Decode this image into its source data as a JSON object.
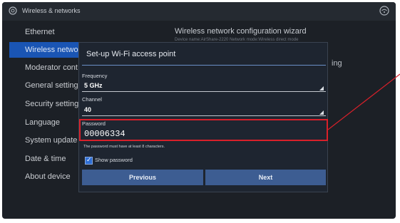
{
  "topbar": {
    "title": "Wireless & networks",
    "settings_icon": "settings-icon",
    "network_icon": "network-icon"
  },
  "sidebar": {
    "items": [
      {
        "label": "Ethernet"
      },
      {
        "label": "Wireless netwo"
      },
      {
        "label": "Moderator cont"
      },
      {
        "label": "General setting"
      },
      {
        "label": "Security setting"
      },
      {
        "label": "Language"
      },
      {
        "label": "System update"
      },
      {
        "label": "Date & time"
      },
      {
        "label": "About device"
      }
    ]
  },
  "right_panel": {
    "wizard_title": "Wireless network configuration wizard",
    "wizard_subtitle": "Device name:AirShare-2220   Network mode:Wireless direct mode",
    "fragment": "ing"
  },
  "dialog": {
    "title": "Set-up Wi-Fi access point",
    "frequency": {
      "label": "Frequency",
      "value": "5 GHz"
    },
    "channel": {
      "label": "Channel",
      "value": "40"
    },
    "password": {
      "label": "Password",
      "value": "00006334"
    },
    "hint": "The password must have at least 8 characters.",
    "show_password": {
      "label": "Show password",
      "checked": true
    },
    "buttons": {
      "previous": "Previous",
      "next": "Next"
    }
  },
  "colors": {
    "highlight": "#d9202a",
    "accent": "#1a55b4",
    "button": "#3d5d92"
  }
}
